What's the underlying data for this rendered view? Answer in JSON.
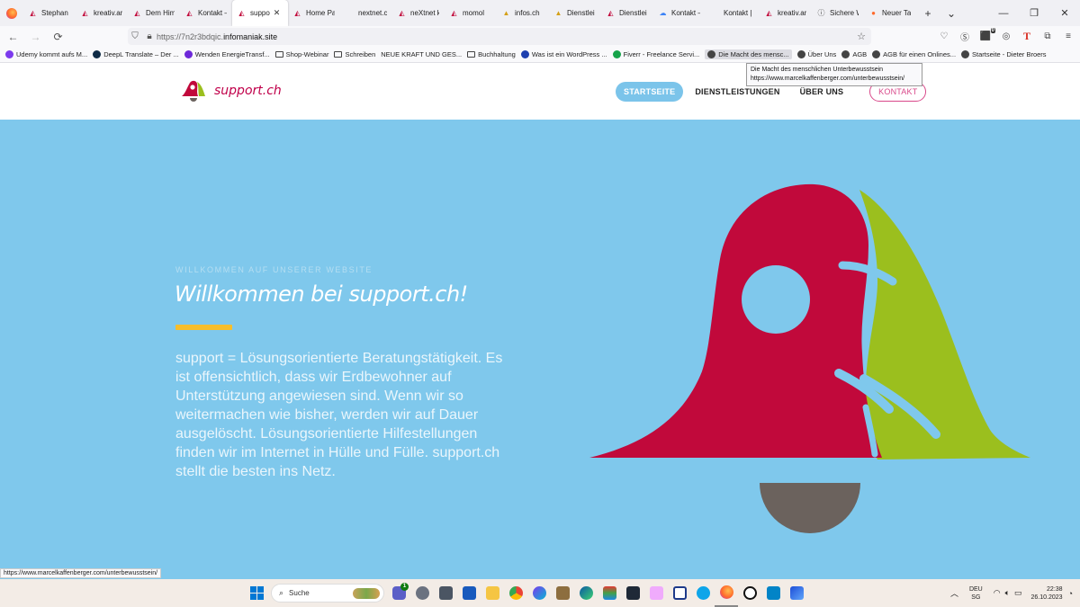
{
  "browser": {
    "tabs": [
      {
        "label": "Stephan I",
        "icon": "support-icon"
      },
      {
        "label": "kreativ.ar",
        "icon": "support-icon"
      },
      {
        "label": "Dem Him",
        "icon": "support-icon"
      },
      {
        "label": "Kontakt –",
        "icon": "support-icon"
      },
      {
        "label": "suppo",
        "icon": "support-icon",
        "active": true
      },
      {
        "label": "Home Pa",
        "icon": "support-icon"
      },
      {
        "label": "nextnet.ch/",
        "icon": "none"
      },
      {
        "label": "neXtnet k",
        "icon": "support-icon"
      },
      {
        "label": "momol",
        "icon": "support-icon"
      },
      {
        "label": "infos.ch",
        "icon": "file-icon"
      },
      {
        "label": "Dienstlei",
        "icon": "file-icon"
      },
      {
        "label": "Dienstlei",
        "icon": "support-icon"
      },
      {
        "label": "Kontakt –",
        "icon": "cloud-icon"
      },
      {
        "label": "Kontakt | rog",
        "icon": "none"
      },
      {
        "label": "kreativ.art",
        "icon": "support-icon"
      },
      {
        "label": "Sichere W",
        "icon": "info-icon"
      },
      {
        "label": "Neuer Tab",
        "icon": "firefox-icon"
      }
    ],
    "url_prefix": "https://7n2r3bdqic.",
    "url_host": "infomaniak.site",
    "bookmarks": [
      "Udemy kommt aufs M...",
      "DeepL Translate – Der ...",
      "Wenden EnergieTransf...",
      "Shop-Webinar",
      "Schreiben",
      "NEUE KRAFT UND GES...",
      "Buchhaltung",
      "Was ist ein WordPress ...",
      "Fiverr - Freelance Servi...",
      "Die Macht des mensc...",
      "Über Uns",
      "AGB",
      "AGB für einen Onlines...",
      "Startseite - Dieter Broers"
    ],
    "tooltip_title": "Die Macht des menschlichen Unterbewusstsein",
    "tooltip_url": "https://www.marcelkaffenberger.com/unterbewusstsein/",
    "status_url": "https://www.marcelkaffenberger.com/unterbewusstsein/",
    "badge_count": "0"
  },
  "site": {
    "logo_text": "support.ch",
    "menu": [
      "STARTSEITE",
      "DIENSTLEISTUNGEN",
      "ÜBER UNS",
      "KONTAKT"
    ],
    "eyebrow": "WILLKOMMEN AUF UNSERER WEBSITE",
    "title": "Willkommen bei support.ch!",
    "body": "support = Lösungsorientierte Beratungstätigkeit. Es ist offensichtlich, dass wir Erdbewohner auf Unterstützung angewiesen sind. Wenn wir so weitermachen wie bisher, werden wir auf Dauer ausgelöscht. Lösungsorientierte Hilfestellungen finden wir im Internet in Hülle und Fülle. support.ch stellt die besten ins Netz.",
    "colors": {
      "hero_bg": "#7fc8ec",
      "bell_red": "#c1093b",
      "bell_green": "#9bbf1e",
      "clapper": "#6b625d",
      "accent": "#f6be2c"
    }
  },
  "taskbar": {
    "search_placeholder": "Suche",
    "chat_badge": "1",
    "lang_top": "DEU",
    "lang_bottom": "SG",
    "time": "22:38",
    "date": "26.10.2023"
  }
}
